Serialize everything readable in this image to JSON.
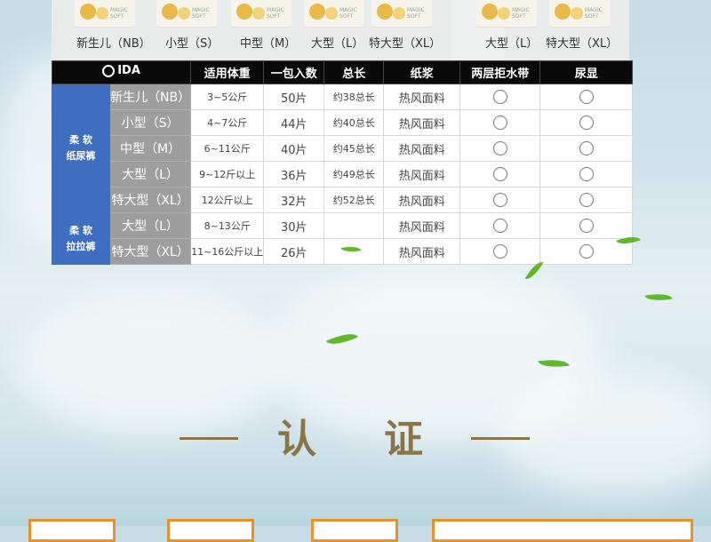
{
  "top_sizes_left": [
    "新生儿（NB）",
    "小型（S）",
    "中型（M）",
    "大型（L）",
    "特大型（XL）"
  ],
  "top_sizes_right": [
    "大型（L）",
    "特大型（XL）"
  ],
  "thumb_brand": "MAGIC SOFT",
  "table": {
    "logo_text": "IDA",
    "headers": [
      "适用体重",
      "一包入数",
      "总长",
      "纸浆",
      "两层拒水带",
      "尿显"
    ],
    "groups": [
      {
        "name_line1": "柔 软",
        "name_line2": "纸尿裤",
        "rows": [
          {
            "size": "新生儿（NB）",
            "weight": "3~5公斤",
            "count": "50片",
            "length": "约38总长",
            "pulp": "热风面料"
          },
          {
            "size": "小型（S）",
            "weight": "4~7公斤",
            "count": "44片",
            "length": "约40总长",
            "pulp": "热风面料"
          },
          {
            "size": "中型（M）",
            "weight": "6~11公斤",
            "count": "40片",
            "length": "约45总长",
            "pulp": "热风面料"
          },
          {
            "size": "大型（L）",
            "weight": "9~12斤以上",
            "count": "36片",
            "length": "约49总长",
            "pulp": "热风面料"
          },
          {
            "size": "特大型（XL）",
            "weight": "12公斤以上",
            "count": "32片",
            "length": "约52总长",
            "pulp": "热风面料"
          }
        ]
      },
      {
        "name_line1": "柔 软",
        "name_line2": "拉拉裤",
        "rows": [
          {
            "size": "大型（L）",
            "weight": "8~13公斤",
            "count": "30片",
            "length": "",
            "pulp": "热风面料"
          },
          {
            "size": "特大型（XL）",
            "weight": "11~16公斤以上",
            "count": "26片",
            "length": "",
            "pulp": "热风面料"
          }
        ]
      }
    ]
  },
  "section_title": "认证",
  "colors": {
    "group_blue": "#3f6dbf",
    "size_gray": "#9e9e9e",
    "header_black": "#0a0a0a",
    "title_brown": "#8a7548",
    "card_orange": "#e8902a",
    "leaf_green": "#63b72d"
  }
}
